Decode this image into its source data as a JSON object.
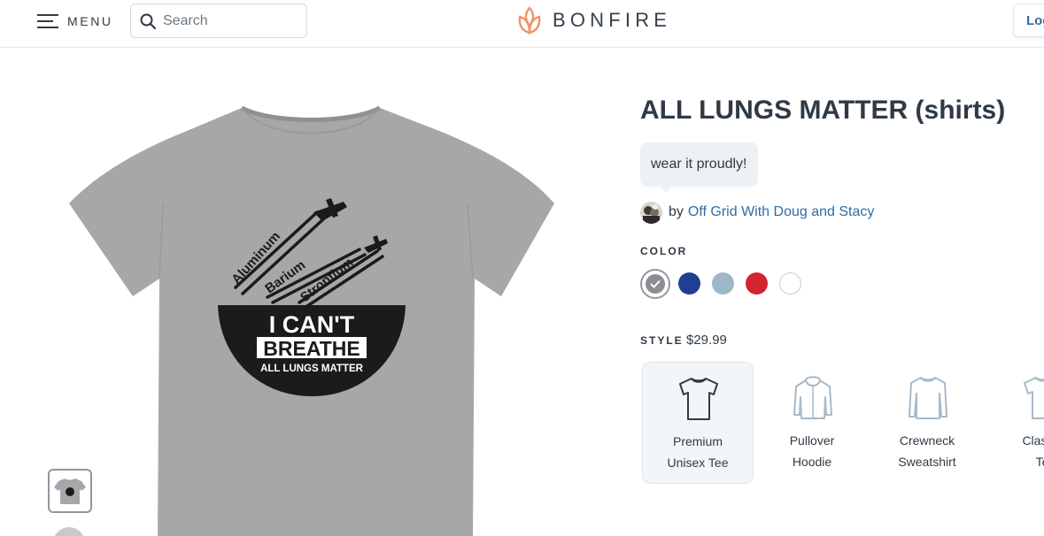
{
  "header": {
    "menu_label": "MENU",
    "search_placeholder": "Search",
    "logo_text": "BONFIRE",
    "login_label": "Log"
  },
  "product": {
    "title": "ALL LUNGS MATTER (shirts)",
    "tagline": "wear it proudly!",
    "by_label": "by",
    "creator": "Off Grid With Doug and Stacy",
    "design_text": {
      "words": [
        "Aluminum",
        "Barium",
        "Strontium"
      ],
      "line1": "I CAN'T",
      "line2": "BREATHE",
      "line3": "ALL LUNGS MATTER"
    },
    "shirt_color": "#a6a7a9"
  },
  "color": {
    "label": "COLOR",
    "swatches": [
      {
        "name": "heather-grey",
        "hex": "#8f8c90",
        "selected": true
      },
      {
        "name": "royal-blue",
        "hex": "#1f3f94",
        "selected": false
      },
      {
        "name": "light-blue",
        "hex": "#9cb7c6",
        "selected": false
      },
      {
        "name": "red",
        "hex": "#d2232f",
        "selected": false
      },
      {
        "name": "white",
        "hex": "#ffffff",
        "selected": false
      }
    ]
  },
  "style": {
    "label": "STYLE",
    "price": "$29.99",
    "options": [
      {
        "line1": "Premium",
        "line2": "Unisex Tee",
        "icon": "tshirt-icon",
        "selected": true
      },
      {
        "line1": "Pullover",
        "line2": "Hoodie",
        "icon": "hoodie-icon",
        "selected": false
      },
      {
        "line1": "Crewneck",
        "line2": "Sweatshirt",
        "icon": "sweatshirt-icon",
        "selected": false
      },
      {
        "line1": "Classic",
        "line2": "Te",
        "icon": "tshirt-icon",
        "selected": false
      }
    ]
  },
  "colors": {
    "text": "#2f3a45",
    "link": "#2e6da4",
    "logo_flame": "#f0926a"
  }
}
